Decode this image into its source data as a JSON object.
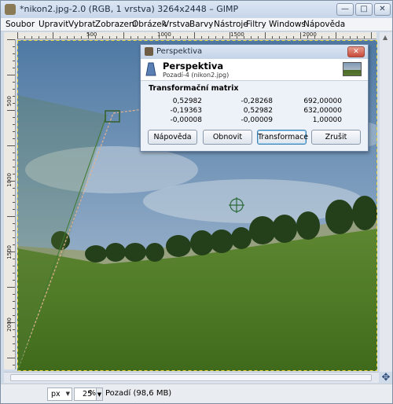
{
  "window": {
    "title": "*nikon2.jpg-2.0 (RGB, 1 vrstva) 3264x2448 – GIMP",
    "minimize_icon": "minimize-icon",
    "maximize_icon": "maximize-icon",
    "close_icon": "close-icon"
  },
  "menu": {
    "items": [
      "Soubor",
      "Upravit",
      "Vybrat",
      "Zobrazení",
      "Obrázek",
      "Vrstva",
      "Barvy",
      "Nástroje",
      "Filtry",
      "Windows",
      "Nápověda"
    ]
  },
  "ruler": {
    "h_labels": [
      "500",
      "1000",
      "1500",
      "2000"
    ],
    "v_labels": [
      "500",
      "1000",
      "1500",
      "2000"
    ]
  },
  "status": {
    "unit": "px",
    "zoom": "25",
    "zoom_unit": "%",
    "layer_info": "Pozadí (98,6 MB)"
  },
  "dialog": {
    "title": "Perspektiva",
    "heading": "Perspektiva",
    "subheading": "Pozadí-4 (nikon2.jpg)",
    "matrix_label": "Transformační matrix",
    "matrix": [
      [
        "0,52982",
        "-0,28268",
        "692,00000"
      ],
      [
        "-0,19363",
        "0,52982",
        "632,00000"
      ],
      [
        "-0,00008",
        "-0,00009",
        "1,00000"
      ]
    ],
    "buttons": {
      "help": "Nápověda",
      "reset": "Obnovit",
      "transform": "Transformace",
      "cancel": "Zrušit"
    },
    "close_icon": "close-icon"
  }
}
